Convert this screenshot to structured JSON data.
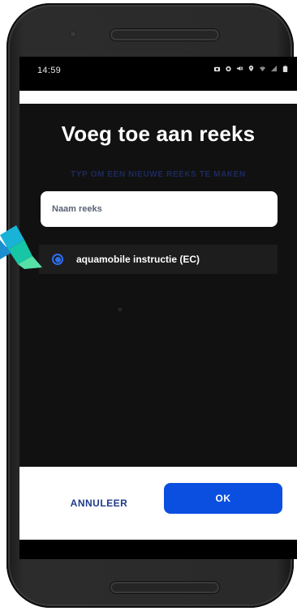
{
  "status_bar": {
    "time": "14:59",
    "icons": [
      "camera-icon",
      "alarm-icon",
      "mute-icon",
      "location-icon",
      "wifi-icon",
      "signal-icon",
      "battery-icon"
    ]
  },
  "dialog": {
    "title": "Voeg toe aan reeks",
    "hint": "TYP OM EEN NIEUWE REEKS TE MAKEN",
    "name_input": {
      "placeholder": "Naam reeks",
      "value": ""
    },
    "series": [
      {
        "label": "aquamobile instructie (EC)",
        "selected": true
      }
    ]
  },
  "buttons": {
    "cancel": "ANNULEER",
    "ok": "OK"
  },
  "colors": {
    "accent": "#0a4fe0",
    "radio": "#2d6ef0",
    "dialog_bg": "#111111",
    "row_bg": "#1d1d1d",
    "hint": "#1d2a5e"
  }
}
